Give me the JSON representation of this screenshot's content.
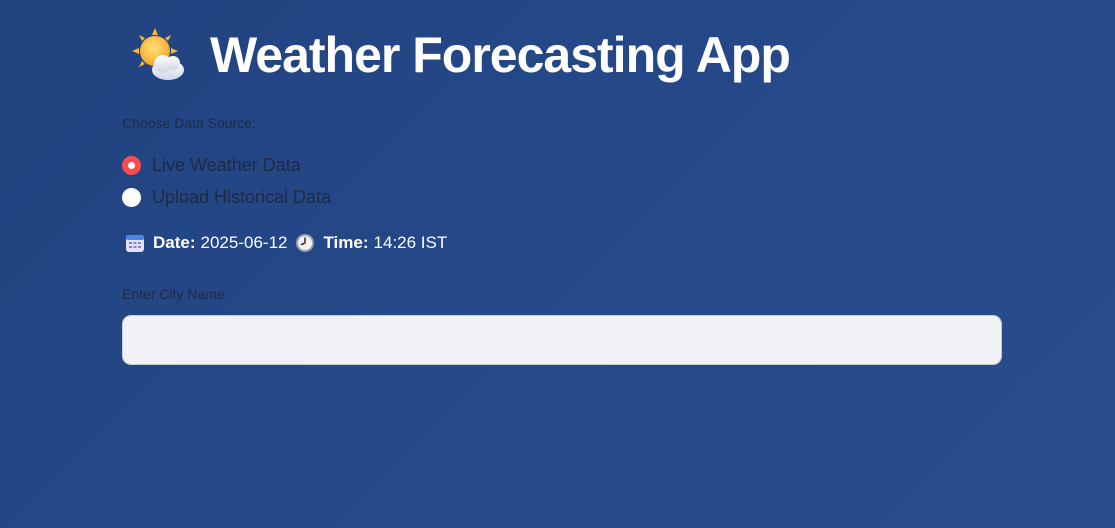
{
  "app": {
    "title": "Weather Forecasting App",
    "title_icon": "sun-behind-cloud-icon"
  },
  "data_source": {
    "label": "Choose Data Source:",
    "options": [
      {
        "label": "Live Weather Data",
        "selected": true
      },
      {
        "label": "Upload Historical Data",
        "selected": false
      }
    ]
  },
  "datetime": {
    "date_icon": "calendar-icon",
    "date_label": "Date:",
    "date_value": "2025-06-12",
    "time_icon": "clock-icon",
    "time_label": "Time:",
    "time_value": "14:26 IST"
  },
  "city": {
    "label": "Enter City Name",
    "value": "",
    "placeholder": ""
  },
  "colors": {
    "background": "#24478a",
    "radio_selected": "#ff4b4b",
    "input_background": "#f0f2f6",
    "title_text": "#ffffff"
  }
}
